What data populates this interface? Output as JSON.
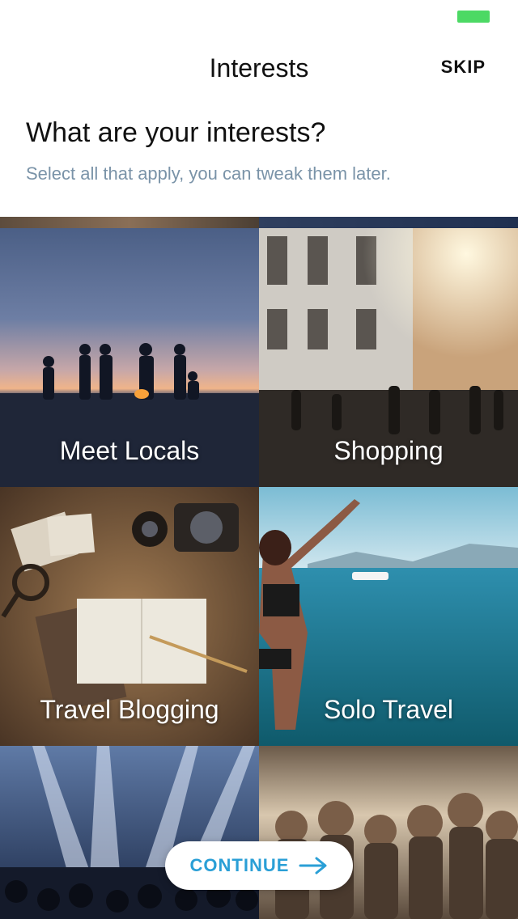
{
  "nav": {
    "title": "Interests",
    "skip_label": "SKIP"
  },
  "header": {
    "headline": "What are your interests?",
    "subheadline": "Select all that apply, you can tweak them later."
  },
  "tiles": [
    {
      "label": "Meet Locals",
      "image": "bonfire-beach-sunset"
    },
    {
      "label": "Shopping",
      "image": "city-street-crowd"
    },
    {
      "label": "Travel Blogging",
      "image": "map-camera-notebook"
    },
    {
      "label": "Solo Travel",
      "image": "jumping-into-sea"
    },
    {
      "label": "",
      "image": "concert-lights"
    },
    {
      "label": "",
      "image": "festival-crowd"
    }
  ],
  "footer": {
    "continue_label": "CONTINUE",
    "continue_icon": "arrow-right-icon"
  },
  "colors": {
    "accent": "#2a9fd6",
    "subtext": "#7a93a8",
    "battery": "#4cd964"
  }
}
